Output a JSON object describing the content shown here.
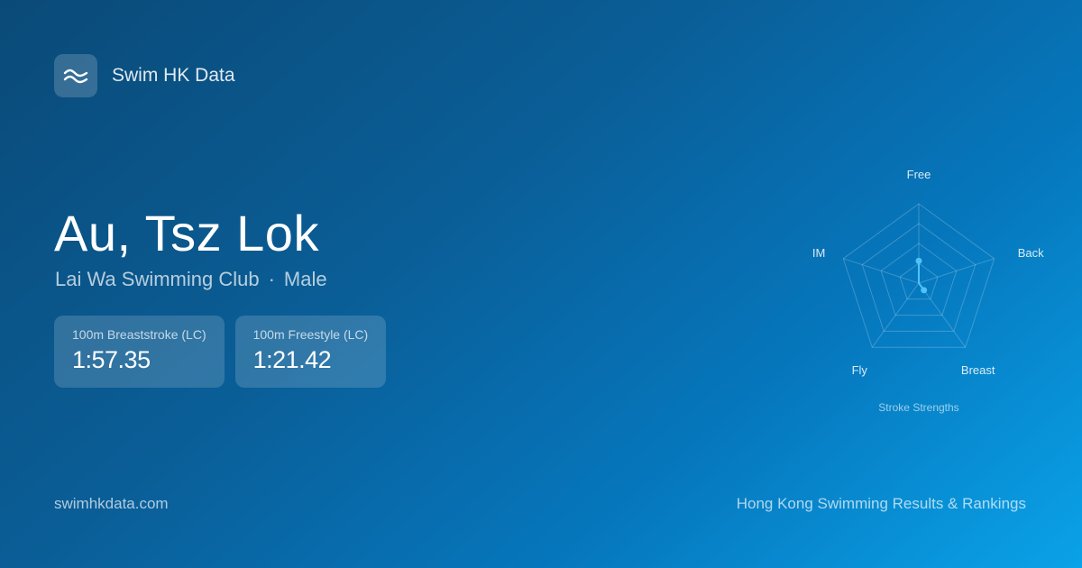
{
  "brand": {
    "name": "Swim HK Data",
    "icon": "waves-icon"
  },
  "athlete": {
    "name": "Au, Tsz Lok",
    "club": "Lai Wa Swimming Club",
    "separator": "·",
    "gender": "Male"
  },
  "best_times": [
    {
      "event": "100m Breaststroke (LC)",
      "time": "1:57.35"
    },
    {
      "event": "100m Freestyle (LC)",
      "time": "1:21.42"
    }
  ],
  "chart_data": {
    "type": "radar",
    "title": "Stroke Strengths",
    "axes": [
      "Free",
      "Back",
      "Breast",
      "Fly",
      "IM"
    ],
    "values": [
      0.28,
      0.0,
      0.11,
      0.0,
      0.0
    ],
    "range": [
      0,
      1
    ],
    "rings": 4,
    "colors": {
      "series": "#4fc3f7",
      "grid": "rgba(255,255,255,0.22)"
    }
  },
  "footer": {
    "site": "swimhkdata.com",
    "tagline": "Hong Kong Swimming Results & Rankings"
  }
}
